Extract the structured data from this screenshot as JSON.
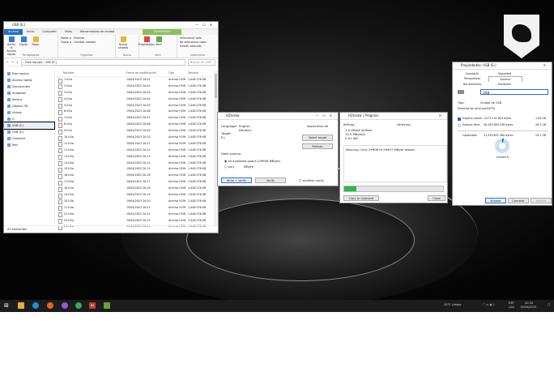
{
  "explorer": {
    "title": "USB (E:)",
    "tabs": [
      "Archivo",
      "Inicio",
      "Compartir",
      "Vista"
    ],
    "context_tab": "Herramientas de unidad",
    "context_group": "Administrar",
    "ribbon": {
      "pin": "Anclar al Acceso rápido",
      "copy": "Copiar",
      "paste": "Pegar",
      "cut": "Cortar",
      "copy_path": "Copiar ruta de acceso",
      "paste_shortcut": "Pegar acceso directo",
      "move_to": "Mover a",
      "copy_to": "Copiar a",
      "delete": "Eliminar",
      "rename": "Cambiar nombre",
      "new_folder": "Nueva carpeta",
      "properties": "Propiedades",
      "open": "Abrir",
      "select_all": "Seleccionar todo",
      "select_none": "No seleccionar nada",
      "invert": "Invertir selección",
      "groups": [
        "Portapapeles",
        "Organizar",
        "Nuevo",
        "Abrir",
        "Seleccionar"
      ]
    },
    "address": "› Este equipo › USB (E:)",
    "search_placeholder": "Buscar en USB",
    "columns": [
      "Nombre",
      "Fecha de modificación",
      "Tipo",
      "Tamaño"
    ],
    "nav": [
      {
        "label": "Este equipo"
      },
      {
        "label": "Acceso rápido"
      },
      {
        "label": "Documentos"
      },
      {
        "label": "Imágenes"
      },
      {
        "label": "Música"
      },
      {
        "label": "Objetos 3D"
      },
      {
        "label": "Vídeos"
      },
      {
        "label": "C:"
      },
      {
        "label": "USB (E:)"
      },
      {
        "label": "USB (E:)"
      },
      {
        "label": "OneDrive"
      },
      {
        "label": "Red"
      }
    ],
    "files": [
      {
        "name": "1.h2w",
        "date": "19/04/2023 20:01",
        "type": "Archivo H2W",
        "size": "1.048.576 KB"
      },
      {
        "name": "2.h2w",
        "date": "19/04/2023 20:02",
        "type": "Archivo H2W",
        "size": "1.048.576 KB"
      },
      {
        "name": "3.h2w",
        "date": "19/04/2023 20:03",
        "type": "Archivo H2W",
        "size": "1.048.576 KB"
      },
      {
        "name": "4.h2w",
        "date": "19/04/2023 20:04",
        "type": "Archivo H2W",
        "size": "1.048.576 KB"
      },
      {
        "name": "5.h2w",
        "date": "19/04/2023 20:05",
        "type": "Archivo H2W",
        "size": "1.048.576 KB"
      },
      {
        "name": "6.h2w",
        "date": "19/04/2023 20:06",
        "type": "Archivo H2W",
        "size": "1.048.576 KB"
      },
      {
        "name": "7.h2w",
        "date": "19/04/2023 20:07",
        "type": "Archivo H2W",
        "size": "1.048.576 KB"
      },
      {
        "name": "8.h2w",
        "date": "19/04/2023 20:08",
        "type": "Archivo H2W",
        "size": "1.048.576 KB"
      },
      {
        "name": "9.h2w",
        "date": "19/04/2023 20:09",
        "type": "Archivo H2W",
        "size": "1.048.576 KB"
      },
      {
        "name": "10.h2w",
        "date": "19/04/2023 20:10",
        "type": "Archivo H2W",
        "size": "1.048.576 KB"
      },
      {
        "name": "11.h2w",
        "date": "19/04/2023 20:11",
        "type": "Archivo H2W",
        "size": "1.048.576 KB"
      },
      {
        "name": "12.h2w",
        "date": "19/04/2023 20:12",
        "type": "Archivo H2W",
        "size": "1.048.576 KB"
      },
      {
        "name": "13.h2w",
        "date": "19/04/2023 20:13",
        "type": "Archivo H2W",
        "size": "1.048.576 KB"
      },
      {
        "name": "14.h2w",
        "date": "19/04/2023 20:14",
        "type": "Archivo H2W",
        "size": "1.048.576 KB"
      },
      {
        "name": "15.h2w",
        "date": "19/04/2023 20:15",
        "type": "Archivo H2W",
        "size": "1.048.576 KB"
      },
      {
        "name": "16.h2w",
        "date": "19/04/2023 20:16",
        "type": "Archivo H2W",
        "size": "1.048.576 KB"
      },
      {
        "name": "17.h2w",
        "date": "19/04/2023 20:17",
        "type": "Archivo H2W",
        "size": "1.048.576 KB"
      },
      {
        "name": "18.h2w",
        "date": "19/04/2023 20:18",
        "type": "Archivo H2W",
        "size": "1.048.576 KB"
      },
      {
        "name": "19.h2w",
        "date": "19/04/2023 20:19",
        "type": "Archivo H2W",
        "size": "1.048.576 KB"
      },
      {
        "name": "20.h2w",
        "date": "19/04/2023 20:20",
        "type": "Archivo H2W",
        "size": "1.048.576 KB"
      },
      {
        "name": "21.h2w",
        "date": "19/04/2023 20:21",
        "type": "Archivo H2W",
        "size": "1.048.576 KB"
      },
      {
        "name": "22.h2w",
        "date": "19/04/2023 20:22",
        "type": "Archivo H2W",
        "size": "1.048.576 KB"
      },
      {
        "name": "23.h2w",
        "date": "19/04/2023 20:23",
        "type": "Archivo H2W",
        "size": "1.048.576 KB"
      },
      {
        "name": "24.h2w",
        "date": "19/04/2023 20:24",
        "type": "Archivo H2W",
        "size": "1.048.576 KB"
      }
    ],
    "status": "25 elementos"
  },
  "h2testw": {
    "title": "H2testw",
    "language_label": "Language:",
    "language": "English",
    "language_alt": "Deutsch",
    "site": "www.heise.de",
    "target_label": "Target",
    "target": "E:\\",
    "select_target": "Select target",
    "refresh": "Refresh",
    "space_label": "Data volume",
    "all_space": "all available space (29906 MByte)",
    "only": "only",
    "mbyte": "MByte",
    "write_verify": "Write + Verify",
    "verify": "Verify",
    "endless": "endless verify"
  },
  "progress_win": {
    "title": "H2testw | Progress",
    "writing": "Writing",
    "verifying": "Verifying",
    "written": "1.0 GByte written",
    "rate": "12.0 MByte/s",
    "time": "0:01 left",
    "log": "Warning: Only 29906 of 29907 MByte tested.",
    "progress": 0.12,
    "copy_button": "Copy to clipboard",
    "close_button": "Close"
  },
  "props": {
    "title": "Propiedades: USB (E:)",
    "tabs": [
      "Compartir",
      "Seguridad",
      "Personalizar",
      "General",
      "Herramientas",
      "Hardware"
    ],
    "active_tab": 3,
    "name": "USB",
    "type_label": "Tipo:",
    "type": "Unidad de USB",
    "fs_label": "Sistema de archivos:",
    "fs": "FAT32",
    "used_label": "Espacio usado:",
    "used_bytes": "1.073.741.824 bytes",
    "used_gb": "1,00 GB",
    "free_label": "Espacio libre:",
    "free_bytes": "30.285.889.536 bytes",
    "free_gb": "28,2 GB",
    "cap_label": "Capacidad:",
    "cap_bytes": "31.359.631.360 bytes",
    "cap_gb": "29,2 GB",
    "drive_label": "Unidad E:",
    "used_fraction": 0.04,
    "ok": "Aceptar",
    "cancel": "Cancelar",
    "apply": "Aplicar",
    "colors": {
      "used": "#2a64c5",
      "free": "#c9dff6"
    }
  },
  "taskbar": {
    "weather": "20°C Limpio",
    "lang": "ESP",
    "lang2": "LAA",
    "time": "20:34",
    "date": "19/04/2023",
    "badge": "64"
  }
}
